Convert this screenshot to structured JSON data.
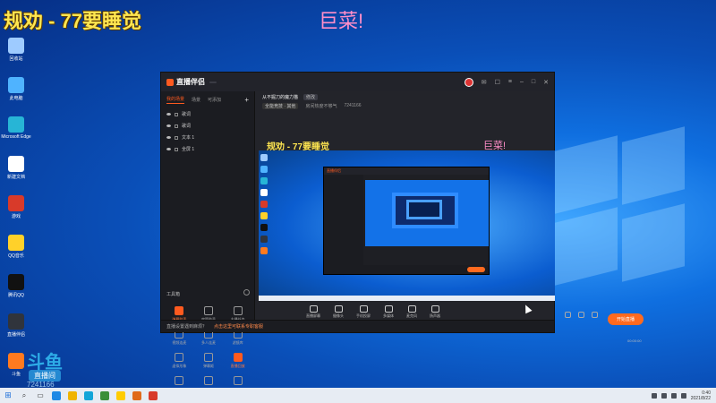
{
  "overlay": {
    "title": "规劝 - 77要睡觉",
    "center_text": "巨菜!",
    "small_text": "",
    "watermark_logo": "斗鱼",
    "watermark_pill": "直播间",
    "watermark_id": "7241166",
    "stream_caption": ""
  },
  "desktop_icons": [
    {
      "label": "回收站",
      "color": "#9ecbff"
    },
    {
      "label": "此电脑",
      "color": "#4fb3ff"
    },
    {
      "label": "Microsoft Edge",
      "color": "#27b5d6"
    },
    {
      "label": "新建文档",
      "color": "#ffffff"
    },
    {
      "label": "游戏",
      "color": "#d83a2a"
    },
    {
      "label": "QQ音乐",
      "color": "#ffd12a"
    },
    {
      "label": "腾讯QQ",
      "color": "#111111"
    },
    {
      "label": "直播伴侣",
      "color": "#30343c"
    },
    {
      "label": "斗鱼",
      "color": "#ff7a1f"
    }
  ],
  "app": {
    "name": "直播伴侣",
    "version_label": "",
    "top_icons": [
      "mail-icon",
      "message-icon",
      "menu-icon",
      "minimize-icon",
      "maximize-icon",
      "close-icon"
    ],
    "left_tabs": [
      "我的场景",
      "场景",
      "可添加"
    ],
    "plus_label": "+",
    "sources": [
      "歌词",
      "歌词",
      "文本 1",
      "全屏 1"
    ],
    "toolbox_title": "工具箱",
    "tools": [
      {
        "label": "弹幕助手",
        "orange": true
      },
      {
        "label": "房管助手",
        "orange": false
      },
      {
        "label": "主播任务",
        "orange": false
      },
      {
        "label": "视频连麦",
        "orange": false
      },
      {
        "label": "多人连麦",
        "orange": false
      },
      {
        "label": "滤镜库",
        "orange": false
      },
      {
        "label": "虚拟形象",
        "orange": false
      },
      {
        "label": "弹幕姬",
        "orange": false
      },
      {
        "label": "直播回放",
        "orange": true
      },
      {
        "label": "",
        "orange": false
      },
      {
        "label": "",
        "orange": false
      },
      {
        "label": "",
        "orange": false
      }
    ],
    "stream_title": "从不掘刀的魔力猫",
    "stream_tag": "修改",
    "stream_category": "全能竞技 · 其他",
    "stream_sub": "房间热度不够气",
    "room_id": "7241166",
    "preview_title": "规劝 - 77要睡觉",
    "preview_center": "巨菜!",
    "controls": [
      "直播屏幕",
      "摄像头",
      "手机投屏",
      "多媒体",
      "麦克风",
      "扬声器"
    ],
    "start_button": "开始直播",
    "timer": "00:00:00",
    "status_text": "直播设置遇到麻烦？",
    "status_link": "点击这里可联系专职客服"
  },
  "taskbar": {
    "time": "0:40",
    "date": "2021/8/22",
    "items": [
      "#1e88e5",
      "#f0b400",
      "#12a5d8",
      "#3a8f3a",
      "#ffcc00",
      "#e06a1a",
      "#d83a2a"
    ]
  }
}
